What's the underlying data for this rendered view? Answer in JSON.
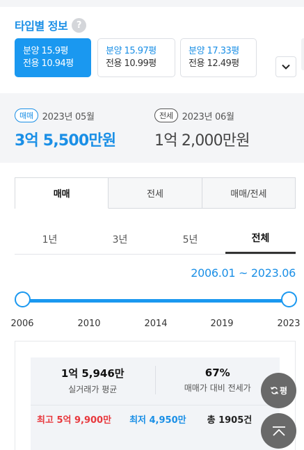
{
  "type_info": {
    "title": "타입별 정보",
    "help": "?",
    "types": [
      {
        "supply": "분양 15.9평",
        "exclusive": "전용 10.94평",
        "active": true
      },
      {
        "supply": "분양 15.97평",
        "exclusive": "전용 10.99평",
        "active": false
      },
      {
        "supply": "분양 17.33평",
        "exclusive": "전용 12.49평",
        "active": false
      }
    ]
  },
  "prices": {
    "sale": {
      "badge": "매매",
      "date": "2023년 05월",
      "value": "3억 5,500만원"
    },
    "lease": {
      "badge": "전세",
      "date": "2023년 06월",
      "value": "1억 2,000만원"
    }
  },
  "deal_tabs": [
    "매매",
    "전세",
    "매매/전세"
  ],
  "period_tabs": [
    "1년",
    "3년",
    "5년",
    "전체"
  ],
  "range": {
    "label": "2006.01 ~ 2023.06",
    "years": [
      "2006",
      "2010",
      "2014",
      "2019",
      "2023"
    ],
    "min": 2006,
    "max": 2023
  },
  "stats": {
    "avg_value": "1억 5,946만",
    "avg_label": "실거래가 평균",
    "ratio_value": "67%",
    "ratio_label": "매매가 대비 전세가",
    "high": "최고 5억 9,900만",
    "low": "최저 4,950만",
    "count": "총 1905건"
  },
  "fab": {
    "unit_label": "평"
  },
  "colors": {
    "accent": "#1a98f0",
    "high": "#e8383d",
    "low": "#1a8fe6"
  }
}
